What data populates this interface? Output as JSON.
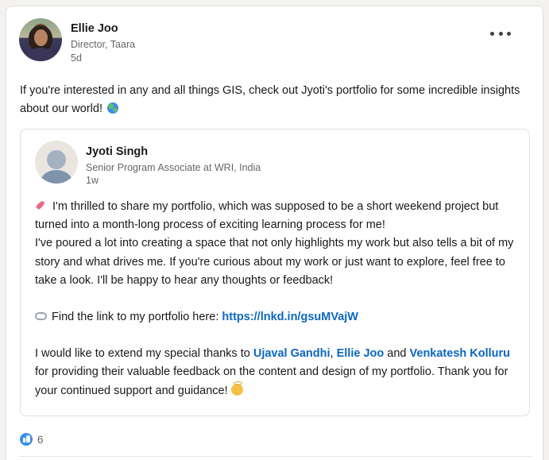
{
  "post": {
    "author": {
      "name": "Ellie Joo",
      "headline": "Director, Taara",
      "time": "5d"
    },
    "more_label": "More options",
    "text": "If you're interested in any and all things GIS, check out Jyoti's portfolio for some incredible insights about our world!",
    "shared": {
      "author": {
        "name": "Jyoti Singh",
        "headline": "Senior Program Associate at WRI, India",
        "time": "1w"
      },
      "para1_line1": "I'm thrilled to share my portfolio, which was supposed to be a short weekend project but turned into a month-long process of exciting learning process for me!",
      "para1_line2": "I've poured a lot into creating a space that not only highlights my work but also tells a bit of my story and what drives me. If you're curious about my work or just want to explore, feel free to take a look. I'll be happy to hear any thoughts or feedback!",
      "link_prefix": "Find the link to my portfolio here:",
      "link_url": "https://lnkd.in/gsuMVajW",
      "thanks_prefix": "I would like to extend my special thanks to",
      "mention1": "Ujaval Gandhi",
      "sep1": ",",
      "mention2": "Ellie Joo",
      "sep2": "and",
      "mention3": "Venkatesh Kolluru",
      "thanks_suffix": "for providing their valuable feedback on the content and design of my portfolio. Thank you for your continued support and guidance!"
    },
    "reactions": {
      "count": "6",
      "icon": "like-icon"
    }
  },
  "colors": {
    "link": "#0a66c2",
    "like": "#378fe9",
    "secondary_text": "#666666"
  }
}
